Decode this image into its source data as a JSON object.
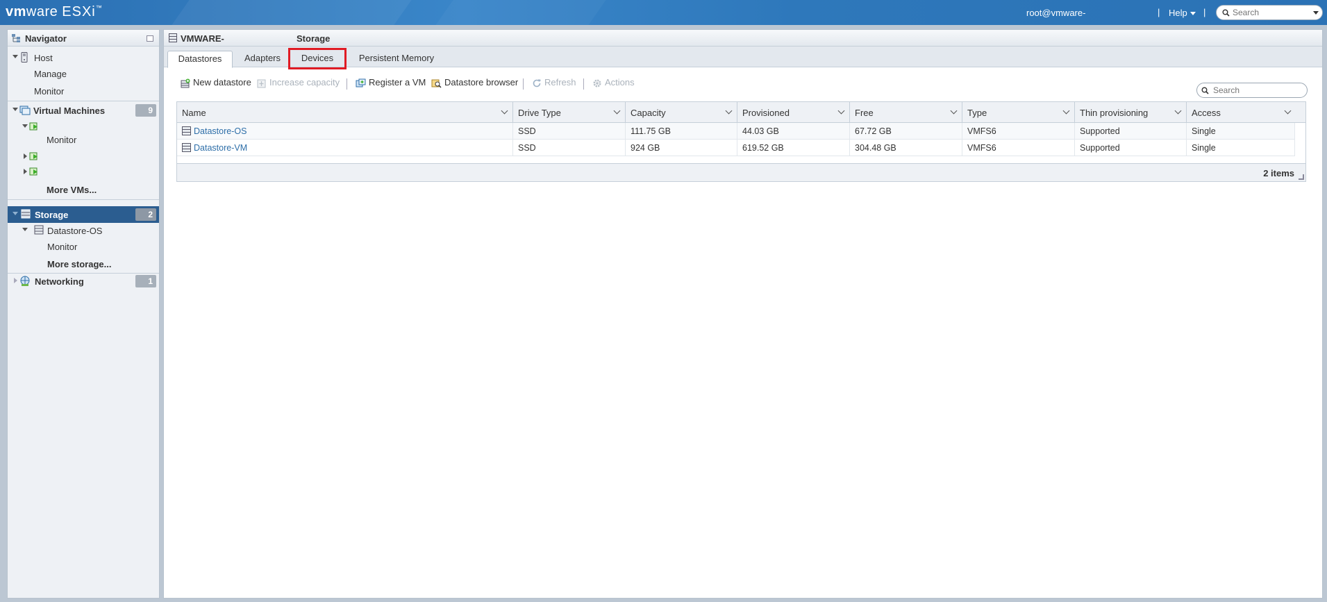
{
  "header": {
    "logo_vm": "vm",
    "logo_ware": "ware",
    "logo_esxi": "ESXi",
    "logo_tm": "™",
    "user": "root@vmware-",
    "sep": "|",
    "help": "Help",
    "search_placeholder": "Search"
  },
  "navigator": {
    "title": "Navigator",
    "host": {
      "label": "Host",
      "children": [
        "Manage",
        "Monitor"
      ]
    },
    "vms": {
      "label": "Virtual Machines",
      "badge": "9",
      "monitor": "Monitor",
      "more": "More VMs..."
    },
    "storage": {
      "label": "Storage",
      "badge": "2",
      "datastore": "Datastore-OS",
      "monitor": "Monitor",
      "more": "More storage..."
    },
    "networking": {
      "label": "Networking",
      "badge": "1"
    }
  },
  "main": {
    "host": "VMWARE-",
    "section": "Storage",
    "tabs": [
      "Datastores",
      "Adapters",
      "Devices",
      "Persistent Memory"
    ],
    "active_tab": "Datastores",
    "highlighted_tab": "Devices",
    "toolbar": {
      "new_datastore": "New datastore",
      "increase_capacity": "Increase capacity",
      "register_vm": "Register a VM",
      "datastore_browser": "Datastore browser",
      "refresh": "Refresh",
      "actions": "Actions"
    },
    "search_placeholder": "Search",
    "table": {
      "columns": [
        "Name",
        "Drive Type",
        "Capacity",
        "Provisioned",
        "Free",
        "Type",
        "Thin provisioning",
        "Access"
      ],
      "rows": [
        [
          "Datastore-OS",
          "SSD",
          "111.75 GB",
          "44.03 GB",
          "67.72 GB",
          "VMFS6",
          "Supported",
          "Single"
        ],
        [
          "Datastore-VM",
          "SSD",
          "924 GB",
          "619.52 GB",
          "304.48 GB",
          "VMFS6",
          "Supported",
          "Single"
        ]
      ],
      "footer": "2 items"
    }
  },
  "colors": {
    "header_blue": "#2e78bb",
    "selected_nav": "#2b5d90",
    "link": "#2d6ea8",
    "highlight_red": "#e01b24"
  }
}
